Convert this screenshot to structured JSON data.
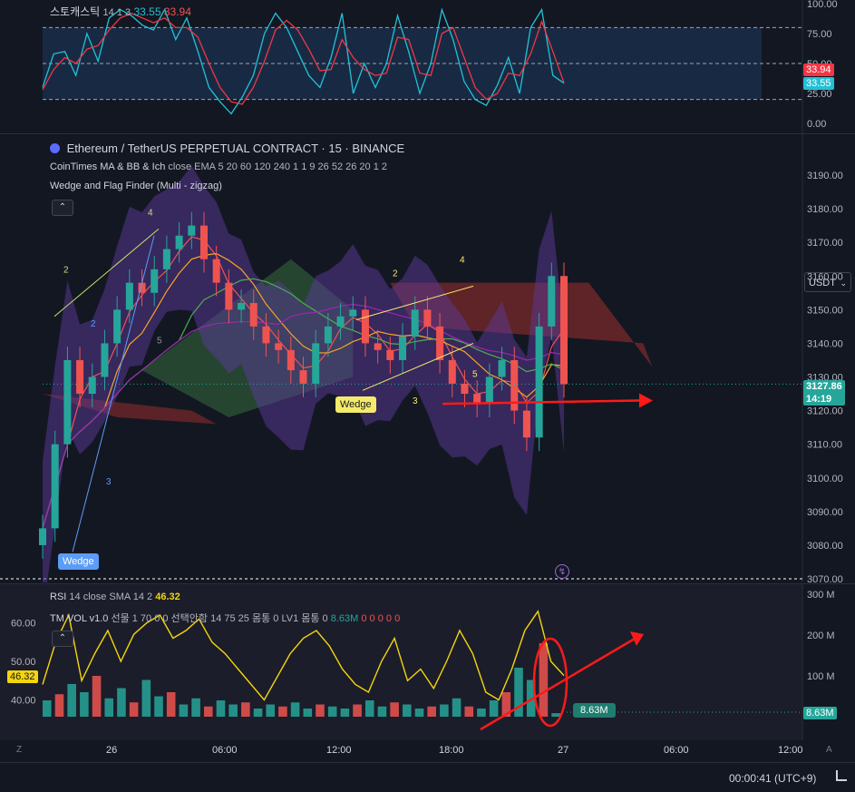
{
  "stoch": {
    "name": "스토캐스틱",
    "params": "14 1 3",
    "k_value": "33.55",
    "d_value": "33.94",
    "axis_ticks": [
      "100.00",
      "75.00",
      "50.00",
      "25.00",
      "0.00"
    ],
    "tag_d": "33.94",
    "tag_k": "33.55"
  },
  "main": {
    "title": "Ethereum / TetherUS PERPETUAL CONTRACT · 15 · BINANCE",
    "indicator1": "CoinTimes MA & BB & Ich",
    "indicator1_params": "close EMA 5 20 60 120 240 1 1 9 26 52 26 20 1 2",
    "indicator2": "Wedge and Flag Finder (Multi - zigzag)",
    "unit": "USDT",
    "price_ticks": [
      "3190.00",
      "3180.00",
      "3170.00",
      "3160.00",
      "3150.00",
      "3140.00",
      "3130.00",
      "3120.00",
      "3110.00",
      "3100.00",
      "3090.00",
      "3080.00",
      "3070.00"
    ],
    "last_price": "3127.86",
    "countdown": "14:19",
    "wedge_label_1": "Wedge",
    "wedge_label_2": "Wedge",
    "zigzag_labels": [
      "2",
      "4",
      "2",
      "5",
      "3",
      "2",
      "4",
      "5",
      "3"
    ]
  },
  "lower": {
    "rsi_name": "RSI",
    "rsi_params": "14 close SMA 14 2",
    "rsi_value": "46.32",
    "vol_name": "TM VOL v1.0",
    "vol_params": "선물 1 70 0 0 선택안함 14 75 25 몸통 0 LV1 몸통 0",
    "vol_value": "8.63M",
    "vol_zeros": "0 0 0 0 0",
    "rsi_ticks": [
      "60.00",
      "50.00",
      "40.00"
    ],
    "rsi_tag": "46.32",
    "vol_ticks": [
      "300 M",
      "200 M",
      "100 M"
    ],
    "vol_tag": "8.63M",
    "vol_inline_tag": "8.63M"
  },
  "time_axis": [
    "26",
    "06:00",
    "12:00",
    "18:00",
    "27",
    "06:00",
    "12:00"
  ],
  "bottom": {
    "clock": "00:00:41 (UTC+9)",
    "corner_left": "Z",
    "corner_right": "A"
  },
  "colors": {
    "up": "#26a69a",
    "down": "#ef5350",
    "bg": "#131722",
    "red_arrow": "#ff1a1a",
    "ichimoku_up": "#2e5a36",
    "ichimoku_down": "#7a2a2a",
    "bb_fill": "#5b3a9a"
  },
  "chart_data": [
    {
      "type": "line",
      "name": "Stochastic",
      "y_range": [
        0,
        100
      ],
      "levels": [
        80,
        50,
        20
      ],
      "series": [
        {
          "name": "%K",
          "values": [
            30,
            58,
            60,
            40,
            75,
            52,
            88,
            95,
            90,
            82,
            78,
            95,
            70,
            88,
            60,
            30,
            18,
            8,
            22,
            40,
            75,
            92,
            80,
            60,
            40,
            30,
            55,
            92,
            25,
            50,
            30,
            50,
            90,
            60,
            25,
            50,
            95,
            70,
            35,
            20,
            15,
            32,
            55,
            25,
            80,
            95,
            40,
            33.55
          ]
        },
        {
          "name": "%D",
          "values": [
            28,
            45,
            55,
            50,
            62,
            65,
            78,
            88,
            92,
            88,
            84,
            88,
            80,
            80,
            72,
            50,
            30,
            18,
            16,
            30,
            52,
            78,
            86,
            78,
            62,
            44,
            45,
            70,
            55,
            45,
            40,
            42,
            72,
            70,
            42,
            40,
            75,
            80,
            55,
            30,
            20,
            25,
            42,
            40,
            58,
            85,
            60,
            33.94
          ]
        }
      ]
    },
    {
      "type": "line",
      "name": "Price (candles)",
      "y_range": [
        3070,
        3195
      ],
      "series": [
        {
          "name": "close",
          "values": [
            3085,
            3110,
            3135,
            3125,
            3130,
            3140,
            3150,
            3158,
            3155,
            3162,
            3168,
            3172,
            3175,
            3165,
            3158,
            3150,
            3152,
            3145,
            3140,
            3138,
            3132,
            3128,
            3140,
            3145,
            3148,
            3150,
            3140,
            3138,
            3135,
            3142,
            3150,
            3145,
            3135,
            3128,
            3125,
            3122,
            3130,
            3135,
            3120,
            3112,
            3145,
            3160,
            3127.86
          ]
        }
      ],
      "last_price": 3127.86
    },
    {
      "type": "bar",
      "name": "Volume",
      "y_range": [
        0,
        300
      ],
      "units": "M",
      "values": [
        40,
        55,
        80,
        60,
        100,
        45,
        70,
        35,
        90,
        50,
        60,
        30,
        45,
        25,
        40,
        30,
        35,
        20,
        30,
        25,
        35,
        20,
        30,
        25,
        20,
        30,
        40,
        25,
        35,
        30,
        20,
        25,
        30,
        45,
        25,
        20,
        40,
        60,
        120,
        90,
        180,
        8.63
      ]
    },
    {
      "type": "line",
      "name": "RSI",
      "y_range": [
        35,
        65
      ],
      "values": [
        44,
        55,
        62,
        45,
        52,
        58,
        50,
        57,
        60,
        62,
        56,
        58,
        61,
        55,
        52,
        48,
        44,
        40,
        46,
        52,
        56,
        58,
        54,
        48,
        44,
        42,
        50,
        56,
        45,
        48,
        43,
        50,
        58,
        52,
        42,
        40,
        48,
        58,
        63,
        50,
        46.32
      ]
    }
  ]
}
